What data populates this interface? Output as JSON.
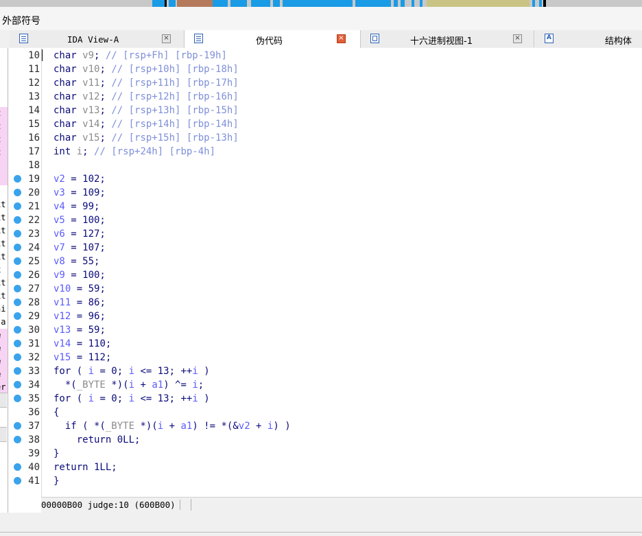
{
  "menu": {
    "title": "外部符号"
  },
  "tabs": [
    {
      "label": "IDA View-A",
      "icon": "document-icon"
    },
    {
      "label": "伪代码",
      "icon": "document-icon"
    },
    {
      "label": "十六进制视图-1",
      "icon": "hex-icon"
    },
    {
      "label": "结构体",
      "icon": "struct-icon"
    }
  ],
  "close_glyph": "×",
  "sidebar": {
    "lines": [
      {
        "text": ""
      },
      {
        "text": "t"
      },
      {
        "text": ":"
      },
      {
        "text": "t"
      },
      {
        "text": "t"
      },
      {
        "text": "t"
      },
      {
        "text": "t"
      },
      {
        "text": ":"
      },
      {
        "text": ":"
      },
      {
        "text": ""
      },
      {
        "text": "xt"
      },
      {
        "text": "xt"
      },
      {
        "text": "xt"
      },
      {
        "text": "xt"
      },
      {
        "text": "xt"
      },
      {
        "text": "x"
      },
      {
        "text": "xt"
      },
      {
        "text": "xt"
      },
      {
        "text": "ni"
      },
      {
        "text": "ta"
      },
      {
        "text": "e"
      },
      {
        "text": "e"
      },
      {
        "text": "e"
      },
      {
        "text": "e"
      },
      {
        "text": "er"
      }
    ]
  },
  "code_lines": [
    {
      "n": "10",
      "dot": false,
      "tokens": [
        [
          "t",
          "char "
        ],
        [
          "g",
          "v9"
        ],
        [
          "t",
          "; "
        ],
        [
          "c",
          "// [rsp+Fh] [rbp-19h]"
        ]
      ]
    },
    {
      "n": "11",
      "dot": false,
      "tokens": [
        [
          "t",
          "char "
        ],
        [
          "g",
          "v10"
        ],
        [
          "t",
          "; "
        ],
        [
          "c",
          "// [rsp+10h] [rbp-18h]"
        ]
      ]
    },
    {
      "n": "12",
      "dot": false,
      "tokens": [
        [
          "t",
          "char "
        ],
        [
          "g",
          "v11"
        ],
        [
          "t",
          "; "
        ],
        [
          "c",
          "// [rsp+11h] [rbp-17h]"
        ]
      ]
    },
    {
      "n": "13",
      "dot": false,
      "tokens": [
        [
          "t",
          "char "
        ],
        [
          "g",
          "v12"
        ],
        [
          "t",
          "; "
        ],
        [
          "c",
          "// [rsp+12h] [rbp-16h]"
        ]
      ]
    },
    {
      "n": "14",
      "dot": false,
      "tokens": [
        [
          "t",
          "char "
        ],
        [
          "g",
          "v13"
        ],
        [
          "t",
          "; "
        ],
        [
          "c",
          "// [rsp+13h] [rbp-15h]"
        ]
      ]
    },
    {
      "n": "15",
      "dot": false,
      "tokens": [
        [
          "t",
          "char "
        ],
        [
          "g",
          "v14"
        ],
        [
          "t",
          "; "
        ],
        [
          "c",
          "// [rsp+14h] [rbp-14h]"
        ]
      ]
    },
    {
      "n": "16",
      "dot": false,
      "tokens": [
        [
          "t",
          "char "
        ],
        [
          "g",
          "v15"
        ],
        [
          "t",
          "; "
        ],
        [
          "c",
          "// [rsp+15h] [rbp-13h]"
        ]
      ]
    },
    {
      "n": "17",
      "dot": false,
      "tokens": [
        [
          "t",
          "int "
        ],
        [
          "g",
          "i"
        ],
        [
          "t",
          "; "
        ],
        [
          "c",
          "// [rsp+24h] [rbp-4h]"
        ]
      ]
    },
    {
      "n": "18",
      "dot": false,
      "tokens": []
    },
    {
      "n": "19",
      "dot": true,
      "tokens": [
        [
          "v",
          "v2"
        ],
        [
          "t",
          " = 102;"
        ]
      ]
    },
    {
      "n": "20",
      "dot": true,
      "tokens": [
        [
          "v",
          "v3"
        ],
        [
          "t",
          " = 109;"
        ]
      ]
    },
    {
      "n": "21",
      "dot": true,
      "tokens": [
        [
          "v",
          "v4"
        ],
        [
          "t",
          " = 99;"
        ]
      ]
    },
    {
      "n": "22",
      "dot": true,
      "tokens": [
        [
          "v",
          "v5"
        ],
        [
          "t",
          " = 100;"
        ]
      ]
    },
    {
      "n": "23",
      "dot": true,
      "tokens": [
        [
          "v",
          "v6"
        ],
        [
          "t",
          " = 127;"
        ]
      ]
    },
    {
      "n": "24",
      "dot": true,
      "tokens": [
        [
          "v",
          "v7"
        ],
        [
          "t",
          " = 107;"
        ]
      ]
    },
    {
      "n": "25",
      "dot": true,
      "tokens": [
        [
          "v",
          "v8"
        ],
        [
          "t",
          " = 55;"
        ]
      ]
    },
    {
      "n": "26",
      "dot": true,
      "tokens": [
        [
          "v",
          "v9"
        ],
        [
          "t",
          " = 100;"
        ]
      ]
    },
    {
      "n": "27",
      "dot": true,
      "tokens": [
        [
          "v",
          "v10"
        ],
        [
          "t",
          " = 59;"
        ]
      ]
    },
    {
      "n": "28",
      "dot": true,
      "tokens": [
        [
          "v",
          "v11"
        ],
        [
          "t",
          " = 86;"
        ]
      ]
    },
    {
      "n": "29",
      "dot": true,
      "tokens": [
        [
          "v",
          "v12"
        ],
        [
          "t",
          " = 96;"
        ]
      ]
    },
    {
      "n": "30",
      "dot": true,
      "tokens": [
        [
          "v",
          "v13"
        ],
        [
          "t",
          " = 59;"
        ]
      ]
    },
    {
      "n": "31",
      "dot": true,
      "tokens": [
        [
          "v",
          "v14"
        ],
        [
          "t",
          " = 110;"
        ]
      ]
    },
    {
      "n": "32",
      "dot": true,
      "tokens": [
        [
          "v",
          "v15"
        ],
        [
          "t",
          " = 112;"
        ]
      ]
    },
    {
      "n": "33",
      "dot": true,
      "tokens": [
        [
          "t",
          "for ( "
        ],
        [
          "v",
          "i"
        ],
        [
          "t",
          " = 0; "
        ],
        [
          "v",
          "i"
        ],
        [
          "t",
          " <= 13; ++"
        ],
        [
          "v",
          "i"
        ],
        [
          "t",
          " )"
        ]
      ]
    },
    {
      "n": "34",
      "dot": true,
      "tokens": [
        [
          "t",
          "  *("
        ],
        [
          "g",
          "_BYTE"
        ],
        [
          "t",
          " *)("
        ],
        [
          "v",
          "i"
        ],
        [
          "t",
          " + "
        ],
        [
          "v",
          "a1"
        ],
        [
          "t",
          ") ^= "
        ],
        [
          "v",
          "i"
        ],
        [
          "t",
          ";"
        ]
      ]
    },
    {
      "n": "35",
      "dot": true,
      "tokens": [
        [
          "t",
          "for ( "
        ],
        [
          "v",
          "i"
        ],
        [
          "t",
          " = 0; "
        ],
        [
          "v",
          "i"
        ],
        [
          "t",
          " <= 13; ++"
        ],
        [
          "v",
          "i"
        ],
        [
          "t",
          " )"
        ]
      ]
    },
    {
      "n": "36",
      "dot": false,
      "tokens": [
        [
          "t",
          "{"
        ]
      ]
    },
    {
      "n": "37",
      "dot": true,
      "tokens": [
        [
          "t",
          "  if ( *("
        ],
        [
          "g",
          "_BYTE"
        ],
        [
          "t",
          " *)("
        ],
        [
          "v",
          "i"
        ],
        [
          "t",
          " + "
        ],
        [
          "v",
          "a1"
        ],
        [
          "t",
          ") != *(&"
        ],
        [
          "v",
          "v2"
        ],
        [
          "t",
          " + "
        ],
        [
          "v",
          "i"
        ],
        [
          "t",
          ") )"
        ]
      ]
    },
    {
      "n": "38",
      "dot": true,
      "tokens": [
        [
          "t",
          "    return 0LL;"
        ]
      ]
    },
    {
      "n": "39",
      "dot": false,
      "tokens": [
        [
          "t",
          "}"
        ]
      ]
    },
    {
      "n": "40",
      "dot": true,
      "tokens": [
        [
          "t",
          "return 1LL;"
        ]
      ]
    },
    {
      "n": "41",
      "dot": true,
      "tokens": [
        [
          "t",
          "}"
        ]
      ]
    }
  ],
  "status": {
    "text": "00000B00 judge:10 (600B00)"
  },
  "colors": {
    "accent_dot": "#3aa3ec",
    "text": "#0a0a7a",
    "variable": "#5a5aff",
    "comment": "#7f8fd8",
    "sidebar_highlight": "#f7d4f4",
    "close_active": "#e0603a"
  }
}
